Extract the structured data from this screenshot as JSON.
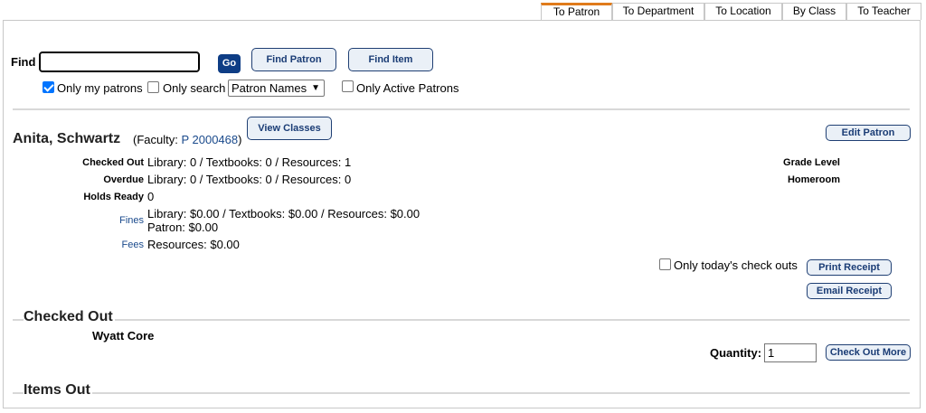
{
  "tabs": [
    {
      "label": "To Patron"
    },
    {
      "label": "To Department"
    },
    {
      "label": "To Location"
    },
    {
      "label": "By Class"
    },
    {
      "label": "To Teacher"
    }
  ],
  "search": {
    "find_label": "Find",
    "find_value": "",
    "go_label": "Go",
    "find_patron_label": "Find Patron",
    "find_item_label": "Find Item",
    "only_my_patrons_label": "Only my patrons",
    "only_my_patrons_checked": true,
    "only_search_label": "Only search",
    "only_search_checked": false,
    "search_select_value": "Patron Names",
    "only_active_label": "Only Active Patrons",
    "only_active_checked": false
  },
  "patron": {
    "name": "Anita, Schwartz",
    "role_prefix": "(Faculty: ",
    "patron_id": "P 2000468",
    "role_suffix": ")",
    "view_classes_label": "View Classes",
    "edit_patron_label": "Edit Patron",
    "checked_out_label": "Checked Out",
    "checked_out_value": "Library: 0 / Textbooks: 0 / Resources: 1",
    "overdue_label": "Overdue",
    "overdue_value": "Library: 0 / Textbooks: 0 / Resources: 0",
    "holds_label": "Holds Ready",
    "holds_value": "0",
    "fines_label": "Fines",
    "fines_value_line1": "Library: $0.00 / Textbooks: $0.00 / Resources: $0.00",
    "fines_value_line2": "Patron: $0.00",
    "fees_label": "Fees",
    "fees_value": "Resources: $0.00",
    "grade_level_label": "Grade Level",
    "homeroom_label": "Homeroom"
  },
  "receipt": {
    "only_today_label": "Only today's check outs",
    "only_today_checked": false,
    "print_label": "Print Receipt",
    "email_label": "Email Receipt"
  },
  "checked_out": {
    "title": "Checked Out",
    "item_name": "Wyatt Core",
    "quantity_label": "Quantity:",
    "quantity_value": "1",
    "check_out_more_label": "Check Out More"
  },
  "items_out": {
    "title": "Items Out"
  }
}
